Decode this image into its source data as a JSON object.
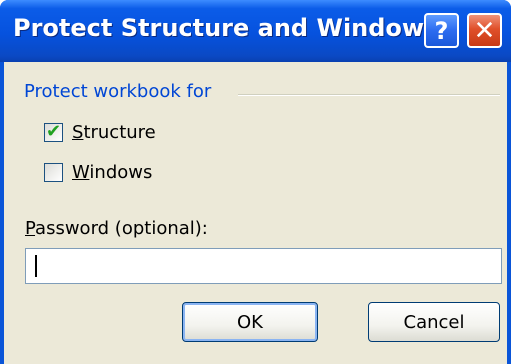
{
  "dialog": {
    "title": "Protect Structure and Windows",
    "help_glyph": "?",
    "close_glyph": "✕"
  },
  "group": {
    "label": "Protect workbook for"
  },
  "structure": {
    "label_first": "S",
    "label_rest": "tructure",
    "checked": true
  },
  "windows": {
    "label_first": "W",
    "label_rest": "indows",
    "checked": false
  },
  "password": {
    "label_first": "P",
    "label_rest": "assword (optional):",
    "value": ""
  },
  "buttons": {
    "ok": "OK",
    "cancel": "Cancel"
  },
  "colors": {
    "titlebar": "#0652de",
    "group_label": "#0046d5",
    "check": "#21a121",
    "close": "#e0502a"
  },
  "icons": {
    "help": "help-icon",
    "close": "close-icon",
    "check": "checkmark-icon"
  }
}
